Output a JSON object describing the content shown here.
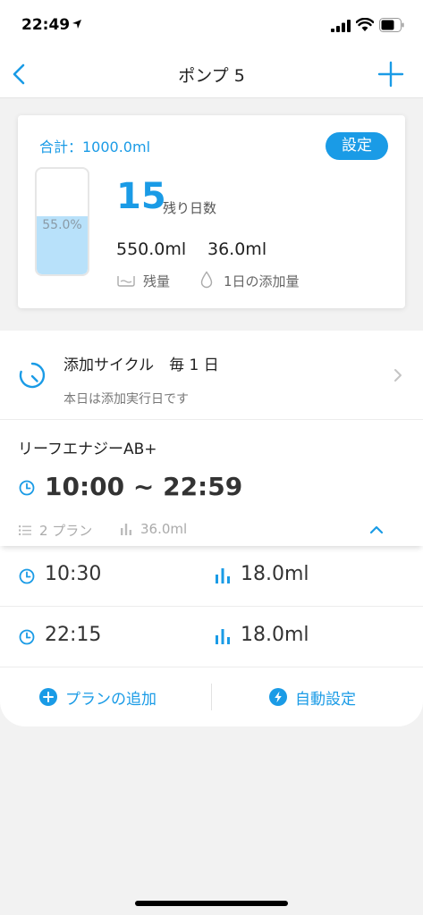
{
  "status_bar": {
    "time": "22:49"
  },
  "nav": {
    "title": "ポンプ 5",
    "back_icon": "chevron-left-icon",
    "add_icon": "plus-icon"
  },
  "summary": {
    "total": "合計：1000.0ml",
    "settings_label": "設定",
    "tank_fill_fraction": 0.55,
    "tank_percent_label": "55.0%",
    "days_left": "15",
    "days_left_label": "残り日数",
    "remaining_value": "550.0ml",
    "daily_value": "36.0ml",
    "remaining_label": "残量",
    "daily_label": "1日の添加量"
  },
  "cycle": {
    "title": "添加サイクル　毎 1 日",
    "subtitle": "本日は添加実行日です"
  },
  "group": {
    "name": "リーフエナジーAB+",
    "time_range": "10:00 ~ 22:59",
    "plan_count": "2 プラン",
    "total_volume": "36.0ml"
  },
  "plans": [
    {
      "time": "10:30",
      "amount": "18.0ml"
    },
    {
      "time": "22:15",
      "amount": "18.0ml"
    }
  ],
  "actions": {
    "add_plan": "プランの追加",
    "auto_setting": "自動設定"
  },
  "colors": {
    "accent": "#1a9be6",
    "tank_fill": "#b8e1fa",
    "background": "#f2f2f2"
  }
}
